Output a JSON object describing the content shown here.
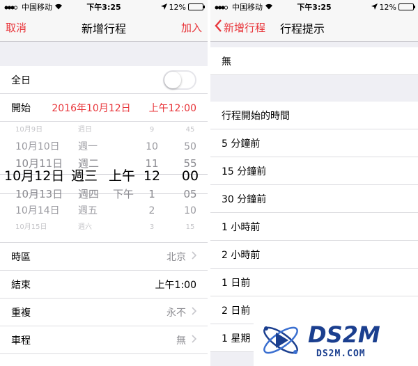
{
  "left": {
    "status": {
      "carrier": "中国移动",
      "time": "下午3:25",
      "battery_text": "12%",
      "battery_level": 0.12
    },
    "nav": {
      "cancel": "取消",
      "title": "新增行程",
      "add": "加入"
    },
    "allday_label": "全日",
    "allday_on": false,
    "start": {
      "label": "開始",
      "date": "2016年10月12日",
      "time": "上午12:00"
    },
    "picker": [
      {
        "date": "10月9日",
        "day": "週日",
        "ampm": "",
        "hour": "9",
        "min": "45"
      },
      {
        "date": "10月10日",
        "day": "週一",
        "ampm": "",
        "hour": "10",
        "min": "50"
      },
      {
        "date": "10月11日",
        "day": "週二",
        "ampm": "",
        "hour": "11",
        "min": "55"
      },
      {
        "date": "10月12日",
        "day": "週三",
        "ampm": "上午",
        "hour": "12",
        "min": "00"
      },
      {
        "date": "10月13日",
        "day": "週四",
        "ampm": "下午",
        "hour": "1",
        "min": "05"
      },
      {
        "date": "10月14日",
        "day": "週五",
        "ampm": "",
        "hour": "2",
        "min": "10"
      },
      {
        "date": "10月15日",
        "day": "週六",
        "ampm": "",
        "hour": "3",
        "min": "15"
      }
    ],
    "picker_selected_index": 3,
    "timezone": {
      "label": "時區",
      "value": "北京"
    },
    "end": {
      "label": "結束",
      "value": "上午1:00"
    },
    "repeat": {
      "label": "重複",
      "value": "永不"
    },
    "travel": {
      "label": "車程",
      "value": "無"
    }
  },
  "right": {
    "status": {
      "carrier": "中国移动",
      "time": "下午3:25",
      "battery_text": "12%",
      "battery_level": 0.12
    },
    "nav": {
      "back": "新增行程",
      "title": "行程提示"
    },
    "none_option": "無",
    "options": [
      "行程開始的時間",
      "5 分鐘前",
      "15 分鐘前",
      "30 分鐘前",
      "1 小時前",
      "2 小時前",
      "1 日前",
      "2 日前",
      "1 星期"
    ]
  },
  "watermark": {
    "logo_text": "DS2M",
    "sub_text": "DS2M.COM"
  },
  "colors": {
    "accent": "#e8353a",
    "group_bg": "#efeff4",
    "secondary_text": "#8e8e93",
    "watermark_blue": "#1b3f8f"
  },
  "icons": [
    "signal-icon",
    "wifi-icon",
    "location-icon",
    "battery-icon",
    "chevron-right-icon",
    "chevron-left-icon"
  ]
}
